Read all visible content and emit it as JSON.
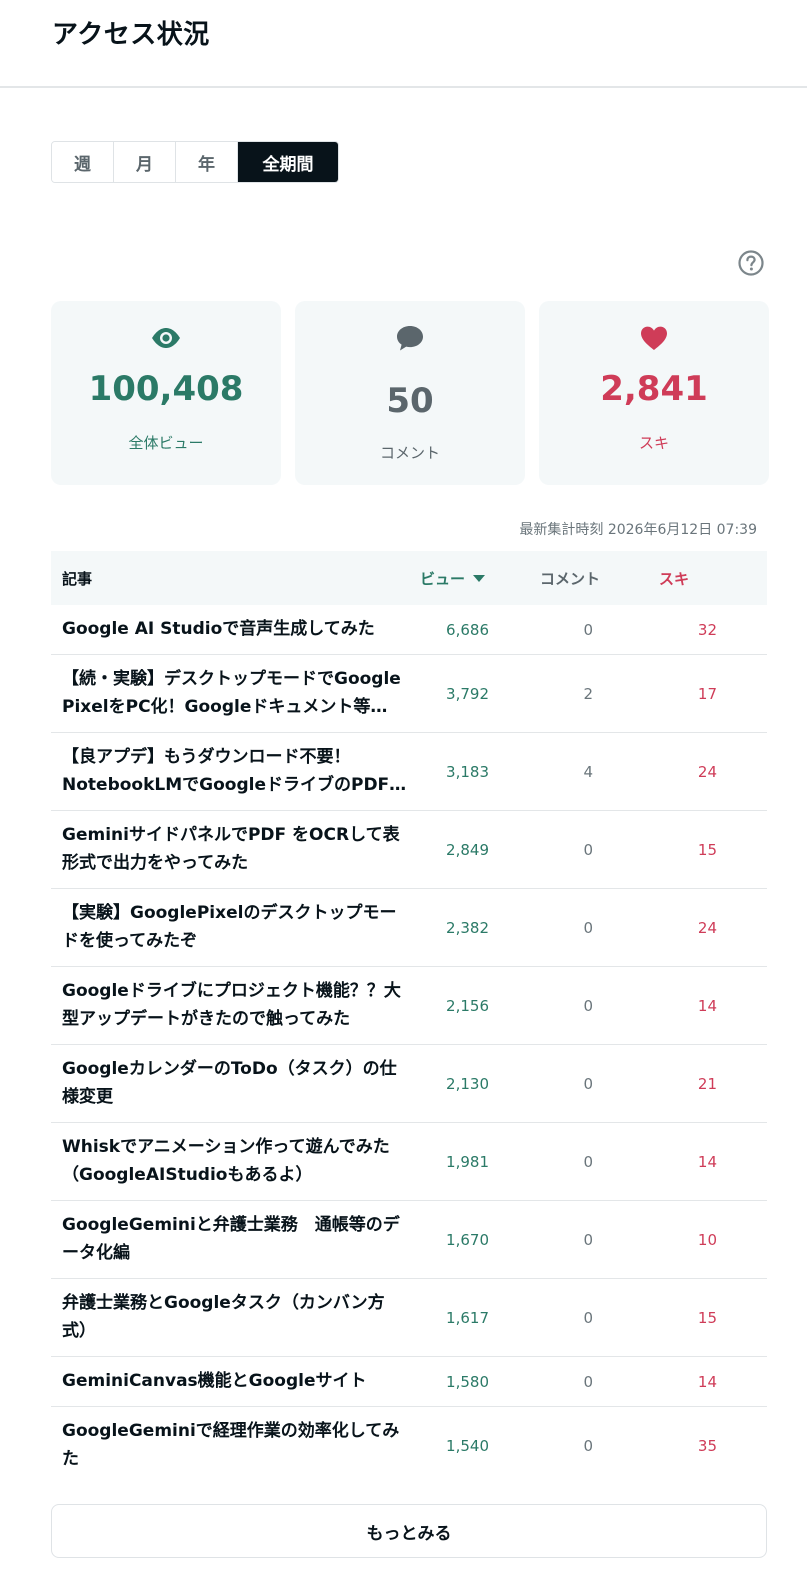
{
  "header": {
    "title": "アクセス状況"
  },
  "tabs": [
    {
      "label": "週",
      "active": false
    },
    {
      "label": "月",
      "active": false
    },
    {
      "label": "年",
      "active": false
    },
    {
      "label": "全期間",
      "active": true
    }
  ],
  "stats": {
    "views": {
      "value": "100,408",
      "label": "全体ビュー",
      "icon": "eye-icon",
      "color": "#2b7a67"
    },
    "comments": {
      "value": "50",
      "label": "コメント",
      "icon": "speech-bubble-icon",
      "color": "#5b666c"
    },
    "likes": {
      "value": "2,841",
      "label": "スキ",
      "icon": "heart-icon",
      "color": "#cf3c58"
    }
  },
  "updated": "最新集計時刻 2026年6月12日 07:39",
  "table": {
    "headers": {
      "article": "記事",
      "views": "ビュー",
      "comments": "コメント",
      "likes": "スキ"
    },
    "rows": [
      {
        "title": "Google AI Studioで音声生成してみた",
        "views": "6,686",
        "comments": "0",
        "likes": "32"
      },
      {
        "title": "【続・実験】デスクトップモードでGoogle PixelをPC化！Googleドキュメント等…",
        "views": "3,792",
        "comments": "2",
        "likes": "17"
      },
      {
        "title": "【良アプデ】もうダウンロード不要！NotebookLMでGoogleドライブのPDFが…",
        "views": "3,183",
        "comments": "4",
        "likes": "24"
      },
      {
        "title": "GeminiサイドパネルでPDF をOCRして表形式で出力をやってみた",
        "views": "2,849",
        "comments": "0",
        "likes": "15"
      },
      {
        "title": "【実験】GooglePixelのデスクトップモードを使ってみたぞ",
        "views": "2,382",
        "comments": "0",
        "likes": "24"
      },
      {
        "title": "Googleドライブにプロジェクト機能？？大型アップデートがきたので触ってみた",
        "views": "2,156",
        "comments": "0",
        "likes": "14"
      },
      {
        "title": "GoogleカレンダーのToDo（タスク）の仕様変更",
        "views": "2,130",
        "comments": "0",
        "likes": "21"
      },
      {
        "title": "Whiskでアニメーション作って遊んでみた（GoogleAIStudioもあるよ）",
        "views": "1,981",
        "comments": "0",
        "likes": "14"
      },
      {
        "title": "GoogleGeminiと弁護士業務　通帳等のデータ化編",
        "views": "1,670",
        "comments": "0",
        "likes": "10"
      },
      {
        "title": "弁護士業務とGoogleタスク（カンバン方式）",
        "views": "1,617",
        "comments": "0",
        "likes": "15"
      },
      {
        "title": "GeminiCanvas機能とGoogleサイト",
        "views": "1,580",
        "comments": "0",
        "likes": "14"
      },
      {
        "title": "GoogleGeminiで経理作業の効率化してみた",
        "views": "1,540",
        "comments": "0",
        "likes": "35"
      }
    ]
  },
  "more_label": "もっとみる"
}
